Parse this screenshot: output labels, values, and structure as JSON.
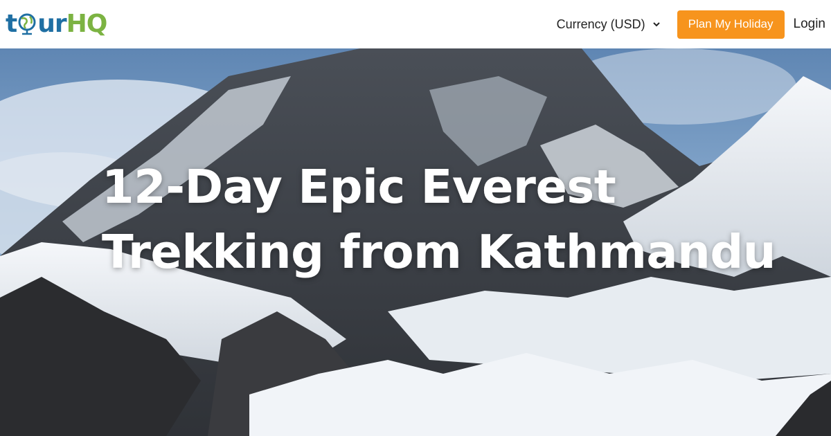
{
  "header": {
    "logo": {
      "part1": "t",
      "part2": "ur",
      "part3": "HQ",
      "globe_icon": "globe-icon"
    },
    "currency_label": "Currency (USD)",
    "plan_button": "Plan My Holiday",
    "login": "Login"
  },
  "hero": {
    "title_line1": "12-Day Epic Everest",
    "title_line2": "Trekking from Kathmandu"
  },
  "colors": {
    "accent": "#f7941d",
    "logo_blue": "#1f6fa3",
    "logo_green": "#7cb342"
  }
}
